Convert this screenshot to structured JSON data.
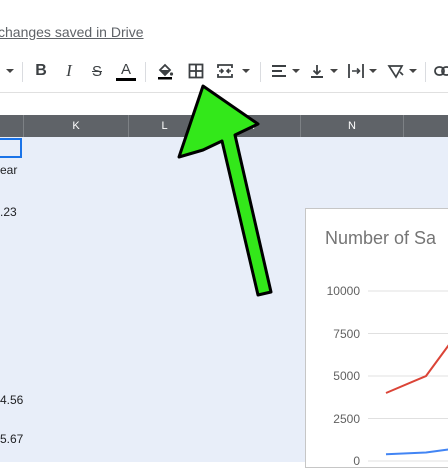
{
  "header": {
    "save_status": "changes saved in Drive"
  },
  "toolbar": {
    "bold_label": "B",
    "italic_label": "I",
    "strike_label": "S",
    "text_color_label": "A"
  },
  "columns": [
    "K",
    "L",
    "M",
    "N"
  ],
  "cells": {
    "r1": "ear",
    "r2": ".23",
    "r3": "4.56",
    "r4": "5.67"
  },
  "chart_data": {
    "type": "line",
    "title": "Number of Sa",
    "xlabel": "",
    "ylabel": "",
    "ylim": [
      0,
      10000
    ],
    "y_ticks": [
      "10000",
      "7500",
      "5000",
      "2500",
      "0"
    ],
    "series": [
      {
        "color": "#db4437",
        "values": [
          4000,
          5000,
          7000
        ]
      },
      {
        "color": "#4285f4",
        "values": [
          400,
          500,
          700
        ]
      }
    ]
  },
  "annotation": {
    "arrow_color": "#33e81a"
  }
}
